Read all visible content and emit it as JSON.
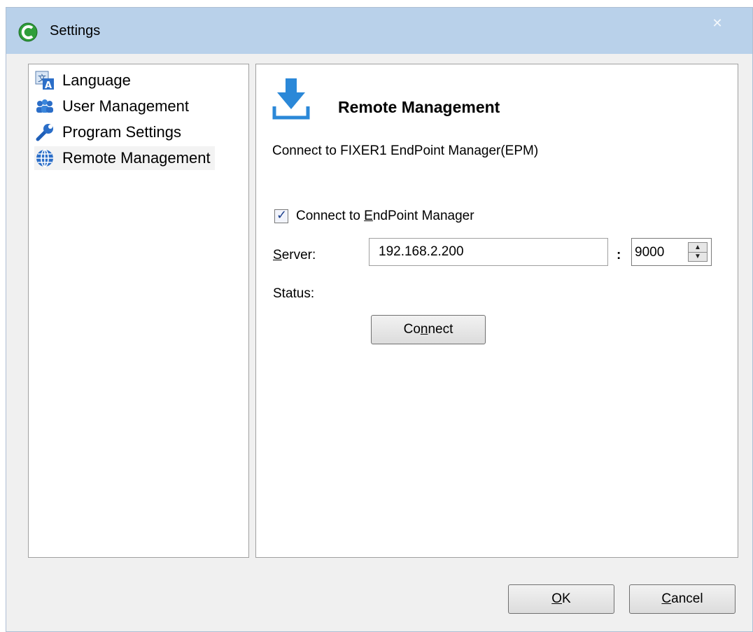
{
  "window": {
    "title": "Settings",
    "close_glyph": "✕"
  },
  "sidebar": {
    "items": [
      {
        "label": "Language",
        "icon": "language-icon"
      },
      {
        "label": "User Management",
        "icon": "users-icon"
      },
      {
        "label": "Program Settings",
        "icon": "wrench-icon"
      },
      {
        "label": "Remote Management",
        "icon": "globe-icon",
        "selected": true
      }
    ]
  },
  "content": {
    "title": "Remote Management",
    "description": "Connect to FIXER1 EndPoint Manager(EPM)",
    "connect_checkbox": {
      "label_pre": "Connect to ",
      "label_ul": "E",
      "label_post": "ndPoint Manager",
      "checked": true
    },
    "server": {
      "label_ul": "S",
      "label_rest": "erver:",
      "value": "192.168.2.200",
      "separator": ":",
      "port": "9000"
    },
    "status": {
      "label": "Status:"
    },
    "connect_button": {
      "pre": "Co",
      "ul": "n",
      "post": "nect"
    }
  },
  "footer": {
    "ok": {
      "ul": "O",
      "rest": "K"
    },
    "cancel": {
      "ul": "C",
      "rest": "ancel"
    }
  },
  "colors": {
    "titlebar": "#b9d1ea",
    "accent_blue": "#2b88d8",
    "app_green": "#2f9e3a"
  }
}
